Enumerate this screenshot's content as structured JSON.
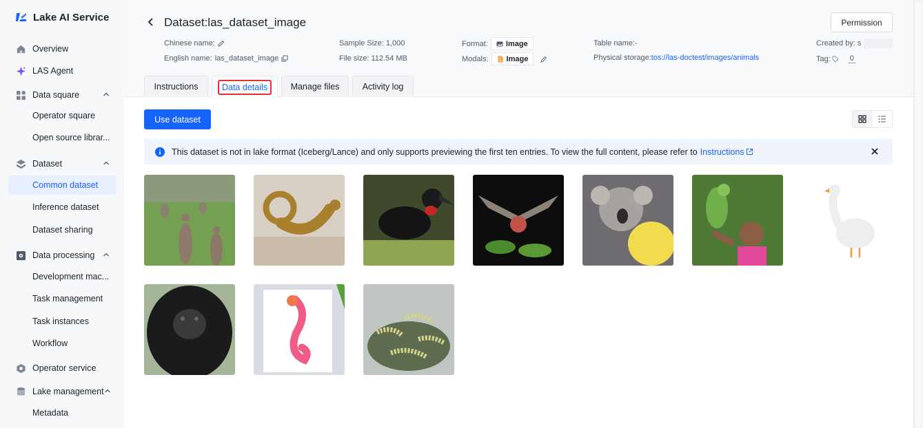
{
  "app": {
    "name": "Lake AI Service"
  },
  "sidebar": {
    "items": [
      {
        "label": "Overview",
        "icon": "home-icon"
      },
      {
        "label": "LAS Agent",
        "icon": "sparkle-icon"
      },
      {
        "label": "Data square",
        "icon": "grid-icon",
        "expanded": true
      },
      {
        "label": "Operator square"
      },
      {
        "label": "Open source librar..."
      },
      {
        "label": "Dataset",
        "icon": "layers-icon",
        "expanded": true
      },
      {
        "label": "Common dataset",
        "active": true
      },
      {
        "label": "Inference dataset"
      },
      {
        "label": "Dataset sharing"
      },
      {
        "label": "Data processing",
        "icon": "gear-box-icon",
        "expanded": true
      },
      {
        "label": "Development mac..."
      },
      {
        "label": "Task management"
      },
      {
        "label": "Task instances"
      },
      {
        "label": "Workflow"
      },
      {
        "label": "Operator service",
        "icon": "hexagon-icon"
      },
      {
        "label": "Lake management",
        "icon": "database-icon",
        "expanded": true
      },
      {
        "label": "Metadata"
      }
    ]
  },
  "header": {
    "title": "Dataset:las_dataset_image",
    "permission_label": "Permission",
    "chinese_name_label": "Chinese name:",
    "english_name_label": "English name:",
    "english_name_value": "las_dataset_image",
    "sample_size": "Sample Size: 1,000",
    "file_size": "File size: 112.54 MB",
    "format_label": "Format:",
    "format_value": "Image",
    "modals_label": "Modals:",
    "modals_value": "Image",
    "table_name": "Table name:-",
    "physical_storage_label": "Physical storage:",
    "physical_storage_value": "tos://las-doctest/images/animals",
    "created_by_label": "Created by: s",
    "tag_label": "Tag:",
    "tag_count": "0"
  },
  "tabs": [
    {
      "label": "Instructions"
    },
    {
      "label": "Data details",
      "active": true
    },
    {
      "label": "Manage files"
    },
    {
      "label": "Activity log"
    }
  ],
  "actions": {
    "use_dataset": "Use dataset",
    "view_mode": "grid"
  },
  "banner": {
    "text": "This dataset is not in lake format (Iceberg/Lance) and only supports previewing the first ten entries. To view the full content, please refer to",
    "link": "Instructions"
  },
  "images": [
    {
      "subject": "kangaroos"
    },
    {
      "subject": "curly-tailed lizard"
    },
    {
      "subject": "ground hornbill"
    },
    {
      "subject": "bat eating fruit"
    },
    {
      "subject": "koala"
    },
    {
      "subject": "parrot with child"
    },
    {
      "subject": "white goose"
    },
    {
      "subject": "gorilla"
    },
    {
      "subject": "seahorse painting"
    },
    {
      "subject": "caterpillars"
    }
  ],
  "colors": {
    "accent": "#1664ff",
    "highlight_box": "#e5312d",
    "sidebar_bg": "#f7f8fa",
    "banner_bg": "#eef3fc"
  }
}
